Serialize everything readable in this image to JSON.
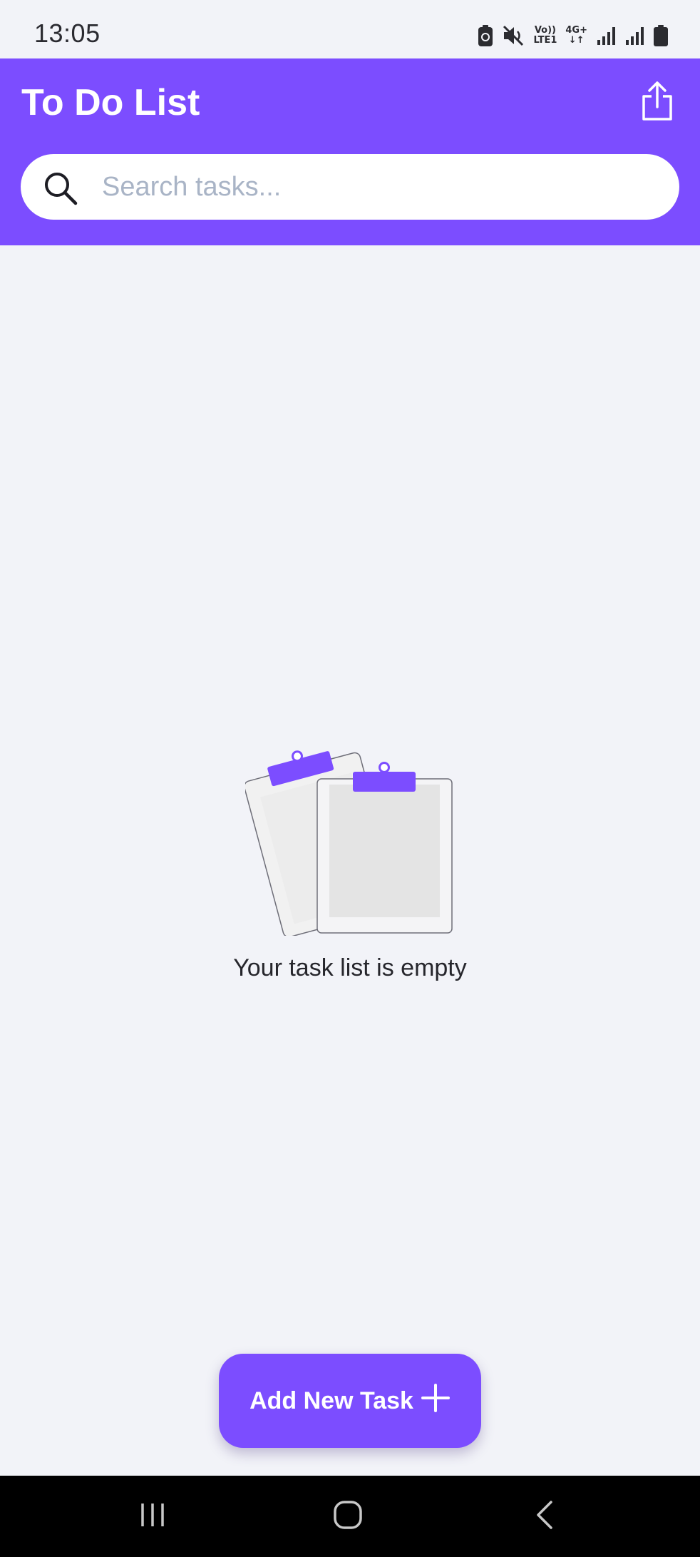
{
  "status_bar": {
    "time": "13:05",
    "icons": [
      "battery-saver-icon",
      "mute-icon",
      "volte-icon",
      "network-4g-icon",
      "signal-icon",
      "signal-icon",
      "battery-icon"
    ],
    "volte_label_top": "Vo))",
    "volte_label_bottom": "LTE1",
    "network_label": "4G+"
  },
  "header": {
    "title": "To Do List",
    "share_icon": "share-icon",
    "background": "#7c4dff"
  },
  "search": {
    "placeholder": "Search tasks...",
    "value": "",
    "icon": "search-icon"
  },
  "empty_state": {
    "illustration": "clipboards-illustration",
    "message": "Your task list is empty"
  },
  "add_button": {
    "label": "Add New Task",
    "icon": "plus-icon",
    "color": "#7c4dff"
  },
  "navigation": {
    "items": [
      "recent-apps-icon",
      "home-icon",
      "back-icon"
    ]
  }
}
